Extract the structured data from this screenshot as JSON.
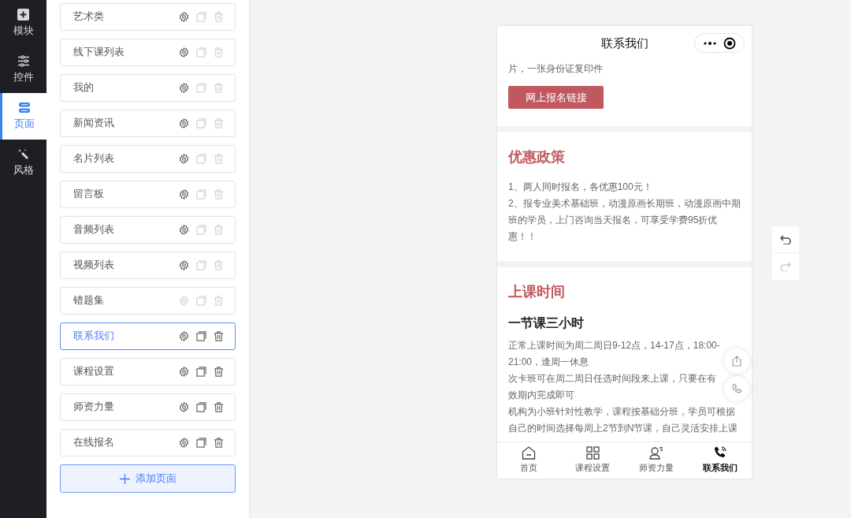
{
  "nav": [
    {
      "label": "模块",
      "selected": false
    },
    {
      "label": "控件",
      "selected": false
    },
    {
      "label": "页面",
      "selected": true
    },
    {
      "label": "风格",
      "selected": false
    }
  ],
  "pages": [
    {
      "name": "艺术类",
      "selected": false,
      "settings_disabled": false,
      "actions_disabled": true
    },
    {
      "name": "线下课列表",
      "selected": false,
      "settings_disabled": false,
      "actions_disabled": true
    },
    {
      "name": "我的",
      "selected": false,
      "settings_disabled": false,
      "actions_disabled": true
    },
    {
      "name": "新闻资讯",
      "selected": false,
      "settings_disabled": false,
      "actions_disabled": true
    },
    {
      "name": "名片列表",
      "selected": false,
      "settings_disabled": false,
      "actions_disabled": true
    },
    {
      "name": "留言板",
      "selected": false,
      "settings_disabled": false,
      "actions_disabled": true
    },
    {
      "name": "音频列表",
      "selected": false,
      "settings_disabled": false,
      "actions_disabled": true
    },
    {
      "name": "视频列表",
      "selected": false,
      "settings_disabled": false,
      "actions_disabled": true
    },
    {
      "name": "错题集",
      "selected": false,
      "settings_disabled": true,
      "actions_disabled": true
    },
    {
      "name": "联系我们",
      "selected": true,
      "settings_disabled": false,
      "actions_disabled": false
    },
    {
      "name": "课程设置",
      "selected": false,
      "settings_disabled": false,
      "actions_disabled": false
    },
    {
      "name": "师资力量",
      "selected": false,
      "settings_disabled": false,
      "actions_disabled": false
    },
    {
      "name": "在线报名",
      "selected": false,
      "settings_disabled": false,
      "actions_disabled": false
    }
  ],
  "add_page_button": "添加页面",
  "phone": {
    "title": "联系我们",
    "top_text": "片，一张身份证复印件",
    "signup_button": "网上报名链接",
    "sections": [
      {
        "heading": "优惠政策",
        "lines": [
          "1、两人同时报名，各优惠100元！",
          "2、报专业美术基础班，动漫原画长期班，动漫原画中期班的学员，上门咨询当天报名，可享受学费95折优惠！！"
        ]
      },
      {
        "heading": "上课时间",
        "subheading": "一节课三小时",
        "lines": [
          "正常上课时间为周二周日9-12点，14-17点，18:00-21:00，逢周一休息",
          "次卡班可在周二周日任选时间段来上课，只要在有效期内完成即可",
          "机构为小班针对性教学，课程按基础分班，学员可根据自己的时间选择每周上2节到N节课，自己灵活安排上课"
        ]
      }
    ],
    "tabs": [
      {
        "label": "首页",
        "selected": false
      },
      {
        "label": "课程设置",
        "selected": false
      },
      {
        "label": "师资力量",
        "selected": false
      },
      {
        "label": "联系我们",
        "selected": true
      }
    ]
  },
  "history": {
    "undo_disabled": false,
    "redo_disabled": true
  }
}
